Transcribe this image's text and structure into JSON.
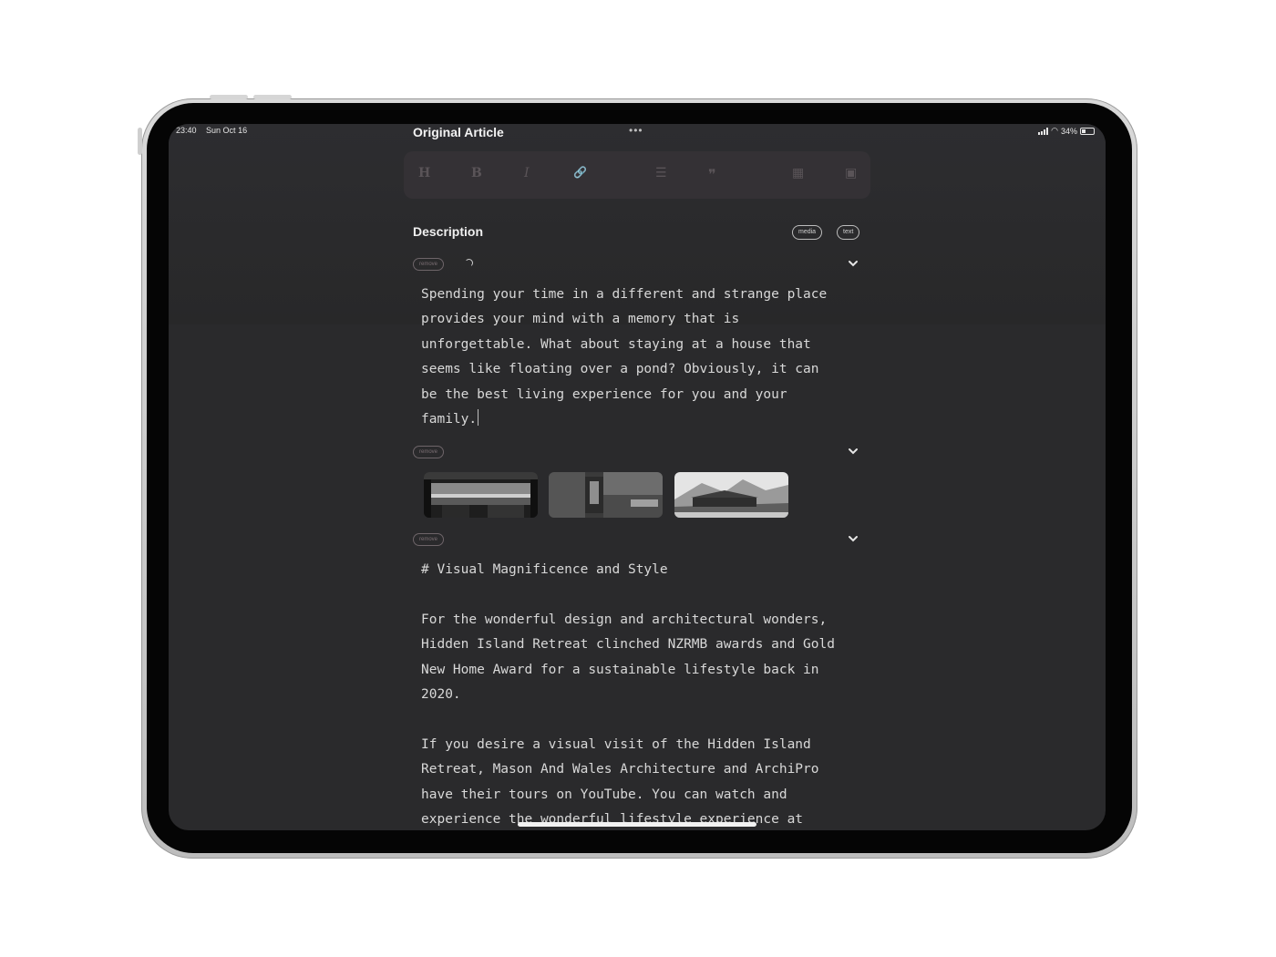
{
  "status_bar": {
    "time": "23:40",
    "date": "Sun Oct 16",
    "battery": "34%"
  },
  "header": {
    "title": "Original Article",
    "more_label": "•••"
  },
  "toolbar": {
    "heading": "H",
    "bold": "B",
    "italic": "I",
    "link": "🔗",
    "list": "☰",
    "quote": "❞",
    "table": "▦",
    "image": "▣"
  },
  "section": {
    "title": "Description",
    "media_label": "media",
    "text_label": "text"
  },
  "blocks": [
    {
      "remove_label": "remove",
      "text": "Spending your time in a different and strange place\nprovides your mind with a memory that is\nunforgettable. What about staying at a house that\nseems like floating over a pond? Obviously, it can\nbe the best living experience for you and your\nfamily."
    },
    {
      "remove_label": "remove"
    },
    {
      "remove_label": "remove",
      "text": "# Visual Magnificence and Style\n\nFor the wonderful design and architectural wonders,\nHidden Island Retreat clinched NZRMB awards and Gold\nNew Home Award for a sustainable lifestyle back in\n2020.\n\nIf you desire a visual visit of the Hidden Island\nRetreat, Mason And Wales Architecture and ArchiPro\nhave their tours on YouTube. You can watch and\nexperience the wonderful lifestyle experience at"
    }
  ]
}
